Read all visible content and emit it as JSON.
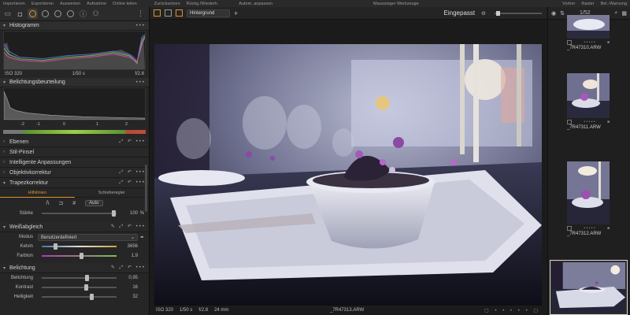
{
  "topmenu": {
    "left": [
      "Importieren",
      "Exportieren",
      "Auswerten",
      "Aufnahme",
      "Online teilen",
      "Zurücksetzen",
      "Rückg./Wiederh.",
      "Autom. anpassen"
    ],
    "center": "Mauszeiger Werkzeuge",
    "right": [
      "Vorher",
      "Raster",
      "Bel.-Warnung"
    ]
  },
  "sections": {
    "histogram": {
      "title": "Histogramm",
      "iso": "ISO 320",
      "shutter": "1/50 s",
      "aperture": "f/2.8"
    },
    "exposure_eval": {
      "title": "Belichtungsbeurteilung",
      "scale": [
        "-2",
        "-1",
        "0",
        "1",
        "2"
      ]
    },
    "collapsed": [
      "Ebenen",
      "Stil-Pinsel",
      "Intelligente Anpassungen",
      "Objektivkorrektur"
    ],
    "keystone": {
      "title": "Trapezkorrektur",
      "tabs": [
        "Hilfslinien",
        "Schieberegler"
      ],
      "auto_label": "Auto",
      "strength_label": "Stärke",
      "strength_value": "100",
      "strength_unit": "%"
    },
    "white_balance": {
      "title": "Weißabgleich",
      "mode_label": "Modus",
      "mode_value": "Benutzerdefiniert",
      "kelvin_label": "Kelvin",
      "kelvin_value": "3656",
      "tint_label": "Farbton",
      "tint_value": "1,9"
    },
    "exposure": {
      "title": "Belichtung",
      "exposure_label": "Belichtung",
      "exposure_value": "0,95",
      "contrast_label": "Kontrast",
      "contrast_value": "16",
      "brightness_label": "Helligkeit",
      "brightness_value": "32"
    }
  },
  "viewer": {
    "layer": "Hintergrund",
    "zoom": "Eingepasst",
    "status": {
      "iso": "ISO 320",
      "shutter": "1/50 s",
      "aperture": "f/2.8",
      "focal": "24 mm",
      "filename": "_7R47313.ARW"
    }
  },
  "browser": {
    "counter": "1/52",
    "thumbs": [
      "_7R47310.ARW",
      "_7R47311.ARW",
      "_7R47312.ARW"
    ]
  }
}
